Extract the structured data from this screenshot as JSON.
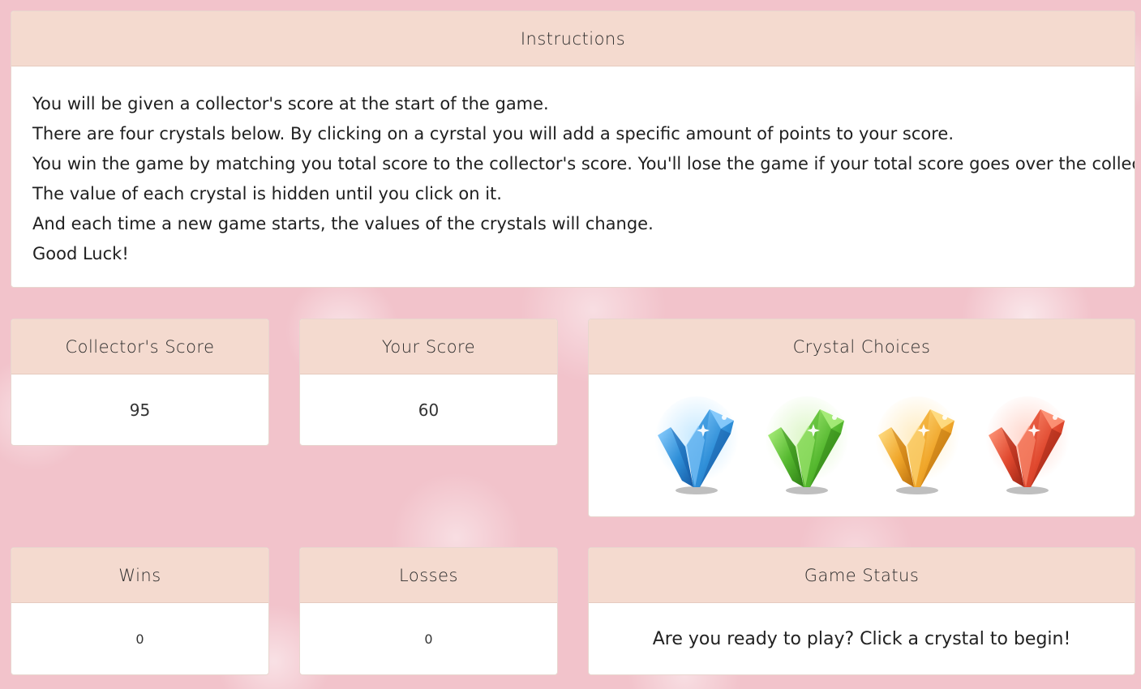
{
  "instructions": {
    "title": "Instructions",
    "lines": [
      "You will be given a collector's score at the start of the game.",
      "There are four crystals below. By clicking on a cyrstal you will add a specific amount of points to your score.",
      "You win the game by matching you total score to the collector's score. You'll lose the game if your total score goes over the collector's.",
      "The value of each crystal is hidden until you click on it.",
      "And each time a new game starts, the values of the crystals will change.",
      "Good Luck!"
    ]
  },
  "collector_score": {
    "title": "Collector's Score",
    "value": "95"
  },
  "your_score": {
    "title": "Your Score",
    "value": "60"
  },
  "crystal_choices": {
    "title": "Crystal Choices",
    "crystals": [
      {
        "icon": "blue-crystal-icon",
        "color": "#2f8fd8",
        "dark": "#1559a3",
        "light": "#8fd0ff",
        "glow": "#bfe6ff"
      },
      {
        "icon": "green-crystal-icon",
        "color": "#55b82f",
        "dark": "#2d7d14",
        "light": "#aef07f",
        "glow": "#d8f5c0"
      },
      {
        "icon": "orange-crystal-icon",
        "color": "#f0a62a",
        "dark": "#b86d0c",
        "light": "#ffe08a",
        "glow": "#ffe9b8"
      },
      {
        "icon": "red-crystal-icon",
        "color": "#e0482e",
        "dark": "#9a2414",
        "light": "#ff9a7d",
        "glow": "#ffd0c4"
      }
    ]
  },
  "wins": {
    "title": "Wins",
    "value": "0"
  },
  "losses": {
    "title": "Losses",
    "value": "0"
  },
  "game_status": {
    "title": "Game Status",
    "message": "Are you ready to play? Click a crystal to begin!"
  }
}
